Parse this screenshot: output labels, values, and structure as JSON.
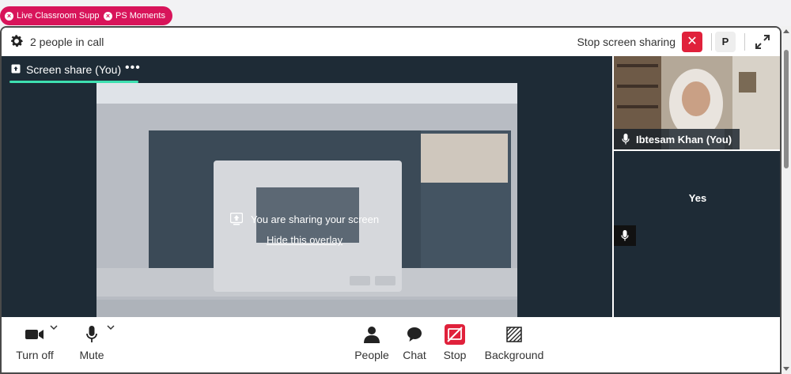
{
  "colors": {
    "brand": "#d8145a",
    "danger": "#e0213b",
    "stage": "#1e2b36",
    "accent": "#3ee0b0"
  },
  "pills": [
    {
      "label": "Live Classroom Support",
      "icon": "close-circle-icon"
    },
    {
      "label": "PS Moments",
      "icon": "close-circle-icon"
    }
  ],
  "topbar": {
    "people_count": "2 people in call",
    "stop_screen_sharing": "Stop screen sharing",
    "close_icon": "close-icon",
    "participant_initial": "P",
    "expand_icon": "expand-icon"
  },
  "stage": {
    "tab_label": "Screen share (You)",
    "more_icon": "more-dots-icon",
    "overlay": {
      "message": "You are sharing your screen",
      "hide_link": "Hide this overlay"
    }
  },
  "tiles": {
    "self": {
      "name": "Ibtesam Khan (You)",
      "mic_icon": "mic-icon"
    },
    "other": {
      "label": "Yes",
      "mic_icon": "mic-icon"
    }
  },
  "controls": {
    "camera": {
      "label": "Turn off",
      "icon": "video-camera-icon"
    },
    "mic": {
      "label": "Mute",
      "icon": "mic-icon"
    },
    "people": {
      "label": "People",
      "icon": "person-icon"
    },
    "chat": {
      "label": "Chat",
      "icon": "chat-bubble-icon"
    },
    "stop": {
      "label": "Stop",
      "icon": "stop-share-icon"
    },
    "background": {
      "label": "Background",
      "icon": "background-icon"
    }
  }
}
